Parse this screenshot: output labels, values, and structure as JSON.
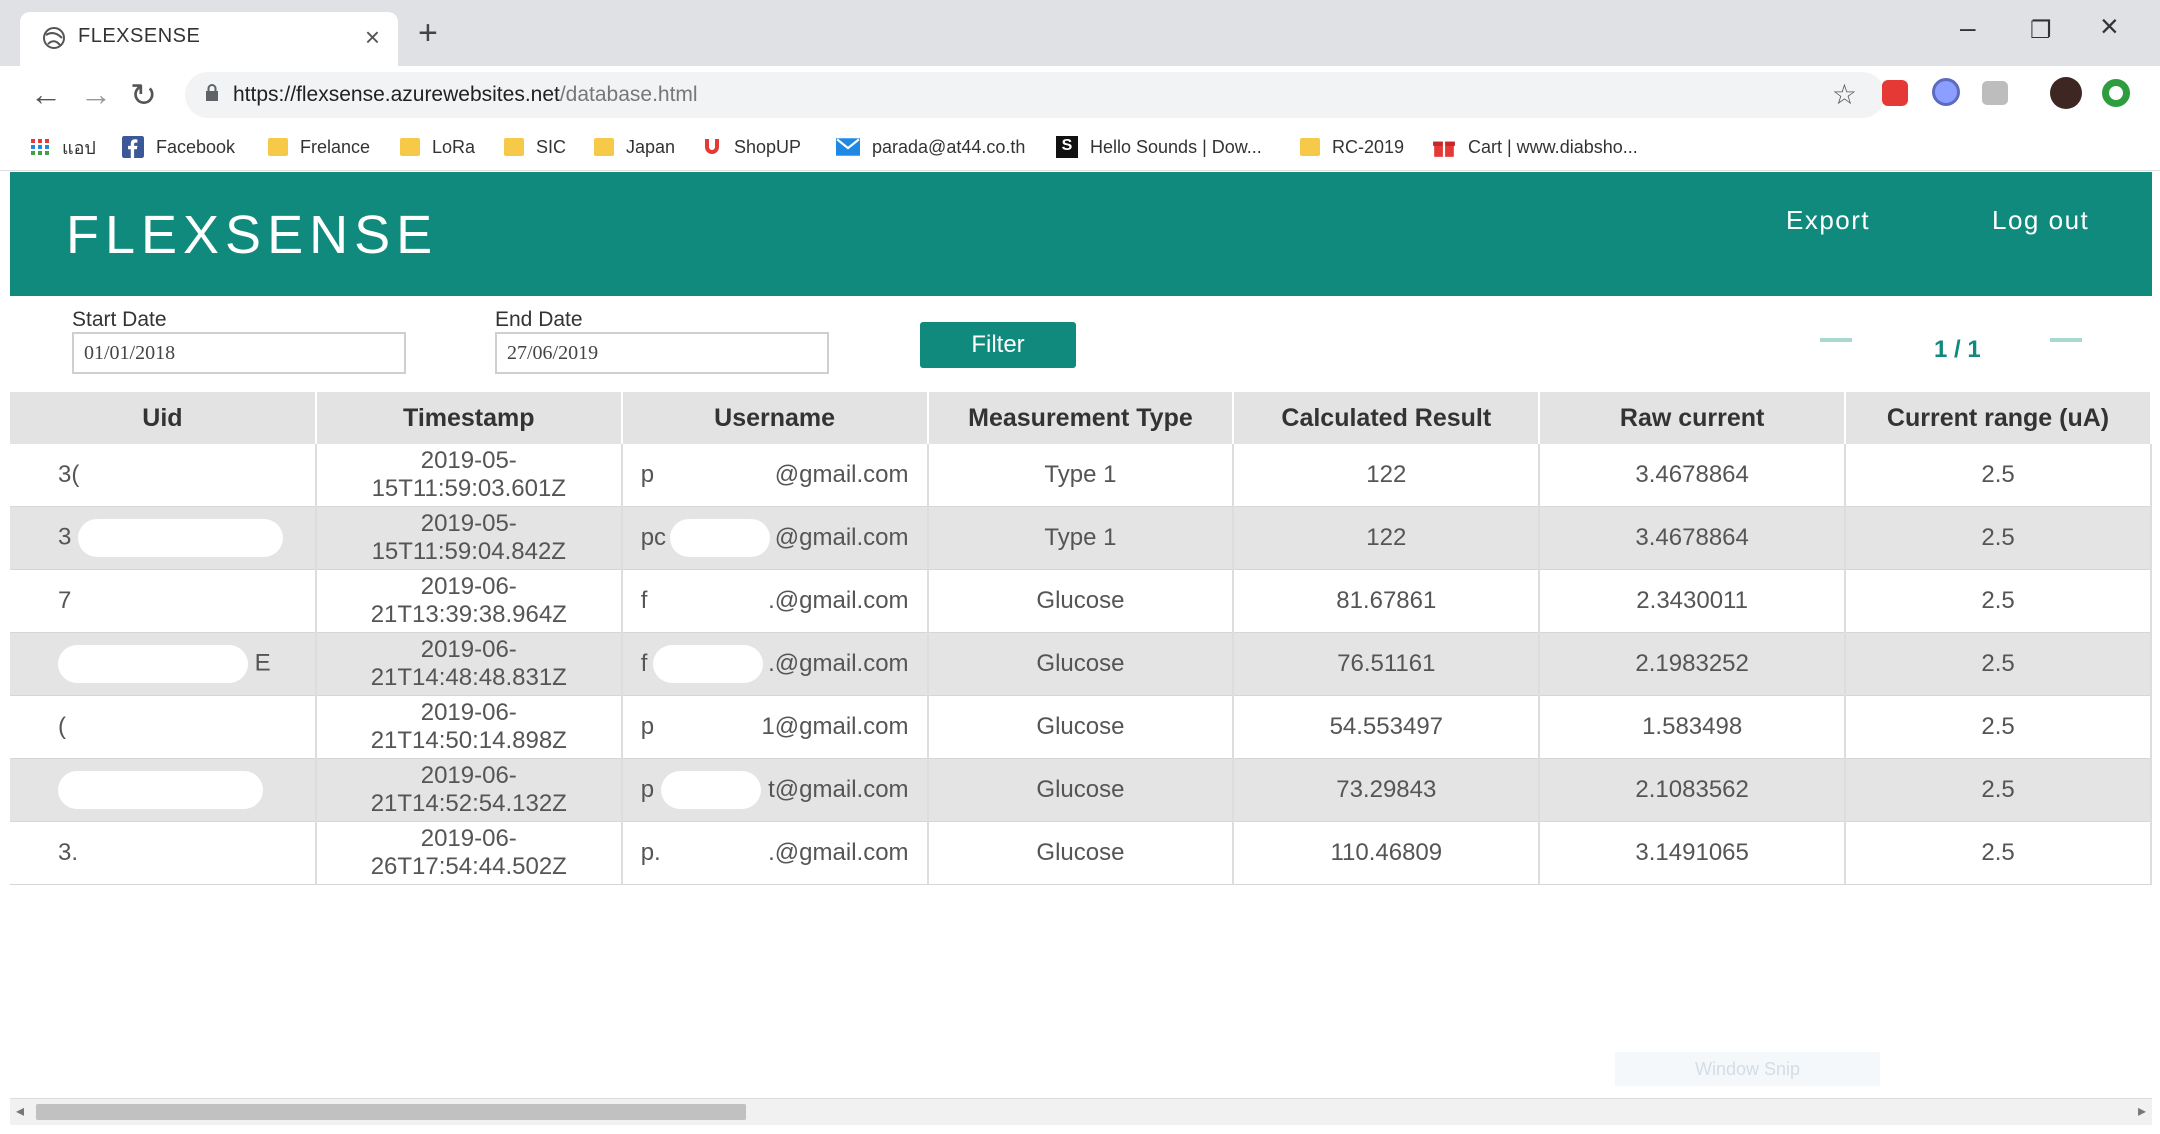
{
  "browser": {
    "tab_title": "FLEXSENSE",
    "tab_close": "×",
    "new_tab": "+",
    "window_controls": {
      "minimize": "–",
      "restore": "❐",
      "close": "×"
    },
    "nav": {
      "back": "←",
      "forward": "→",
      "reload": "↻"
    },
    "url_host": "https://flexsense.azurewebsites.net",
    "url_path": "/database.html",
    "bookmark_star": "☆",
    "bookmarks": [
      {
        "label": "แอป",
        "icon": "apps-grid-icon"
      },
      {
        "label": "Facebook",
        "icon": "facebook-icon"
      },
      {
        "label": "Frelance",
        "icon": "folder-icon"
      },
      {
        "label": "LoRa",
        "icon": "folder-icon"
      },
      {
        "label": "SIC",
        "icon": "folder-icon"
      },
      {
        "label": "Japan",
        "icon": "folder-icon"
      },
      {
        "label": "ShopUP",
        "icon": "magnet-icon"
      },
      {
        "label": "parada@at44.co.th",
        "icon": "mail-icon"
      },
      {
        "label": "Hello Sounds | Dow...",
        "icon": "s-letter-icon"
      },
      {
        "label": "RC-2019",
        "icon": "folder-icon"
      },
      {
        "label": "Cart | www.diabsho...",
        "icon": "gift-icon"
      }
    ]
  },
  "app": {
    "brand": "FLEXSENSE",
    "nav": {
      "export": "Export",
      "logout": "Log out"
    },
    "filters": {
      "start_label": "Start Date",
      "start_value": "01/01/2018",
      "end_label": "End Date",
      "end_value": "27/06/2019",
      "button": "Filter"
    },
    "pagination": {
      "text": "1 / 1"
    },
    "table": {
      "headers": [
        "Uid",
        "Timestamp",
        "Username",
        "Measurement Type",
        "Calculated Result",
        "Raw current",
        "Current range (uA)"
      ],
      "rows": [
        {
          "uid": "3(",
          "ts1": "2019-05-",
          "ts2": "15T11:59:03.601Z",
          "user_prefix": "p",
          "user_suffix": "@gmail.com",
          "type": "Type 1",
          "result": "122",
          "raw": "3.4678864",
          "range": "2.5"
        },
        {
          "uid": "3",
          "ts1": "2019-05-",
          "ts2": "15T11:59:04.842Z",
          "user_prefix": "pc",
          "user_suffix": "@gmail.com",
          "type": "Type 1",
          "result": "122",
          "raw": "3.4678864",
          "range": "2.5"
        },
        {
          "uid": "7",
          "ts1": "2019-06-",
          "ts2": "21T13:39:38.964Z",
          "user_prefix": "f",
          "user_suffix": ".@gmail.com",
          "type": "Glucose",
          "result": "81.67861",
          "raw": "2.3430011",
          "range": "2.5"
        },
        {
          "uid": "E",
          "ts1": "2019-06-",
          "ts2": "21T14:48:48.831Z",
          "user_prefix": "f",
          "user_suffix": ".@gmail.com",
          "type": "Glucose",
          "result": "76.51161",
          "raw": "2.1983252",
          "range": "2.5"
        },
        {
          "uid": "(",
          "ts1": "2019-06-",
          "ts2": "21T14:50:14.898Z",
          "user_prefix": "p",
          "user_suffix": "1@gmail.com",
          "type": "Glucose",
          "result": "54.553497",
          "raw": "1.583498",
          "range": "2.5"
        },
        {
          "uid": "",
          "ts1": "2019-06-",
          "ts2": "21T14:52:54.132Z",
          "user_prefix": "p",
          "user_suffix": "t@gmail.com",
          "type": "Glucose",
          "result": "73.29843",
          "raw": "2.1083562",
          "range": "2.5"
        },
        {
          "uid": "3.",
          "ts1": "2019-06-",
          "ts2": "26T17:54:44.502Z",
          "user_prefix": "p.",
          "user_suffix": ".@gmail.com",
          "type": "Glucose",
          "result": "110.46809",
          "raw": "3.1491065",
          "range": "2.5"
        }
      ]
    },
    "watermark": "Window Snip"
  }
}
